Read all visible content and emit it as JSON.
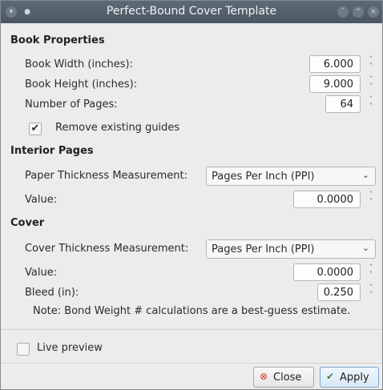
{
  "window": {
    "title": "Perfect-Bound Cover Template",
    "close_glyph": "×",
    "maximize_glyph": "^",
    "minimize_glyph": "ˇ"
  },
  "book_properties": {
    "heading": "Book Properties",
    "width_label": "Book Width (inches):",
    "width_value": "6.000",
    "height_label": "Book Height (inches):",
    "height_value": "9.000",
    "pages_label": "Number of Pages:",
    "pages_value": "64",
    "remove_guides_label": "Remove existing guides",
    "remove_guides_checked": true
  },
  "interior_pages": {
    "heading": "Interior Pages",
    "paper_thickness_label": "Paper Thickness Measurement:",
    "paper_thickness_value": "Pages Per Inch (PPI)",
    "value_label": "Value:",
    "value": "0.0000"
  },
  "cover": {
    "heading": "Cover",
    "cover_thickness_label": "Cover Thickness Measurement:",
    "cover_thickness_value": "Pages Per Inch (PPI)",
    "value_label": "Value:",
    "value": "0.0000",
    "bleed_label": "Bleed (in):",
    "bleed_value": "0.250",
    "note": "Note: Bond Weight # calculations are a best-guess estimate."
  },
  "live_preview": {
    "label": "Live preview",
    "checked": false
  },
  "buttons": {
    "close_label": "Close",
    "apply_label": "Apply"
  },
  "icons": {
    "check": "✔",
    "spin_up": "˄",
    "spin_down": "˅",
    "combo_arrow": "⌄",
    "close_icon": "⊗",
    "apply_icon": "✔"
  }
}
